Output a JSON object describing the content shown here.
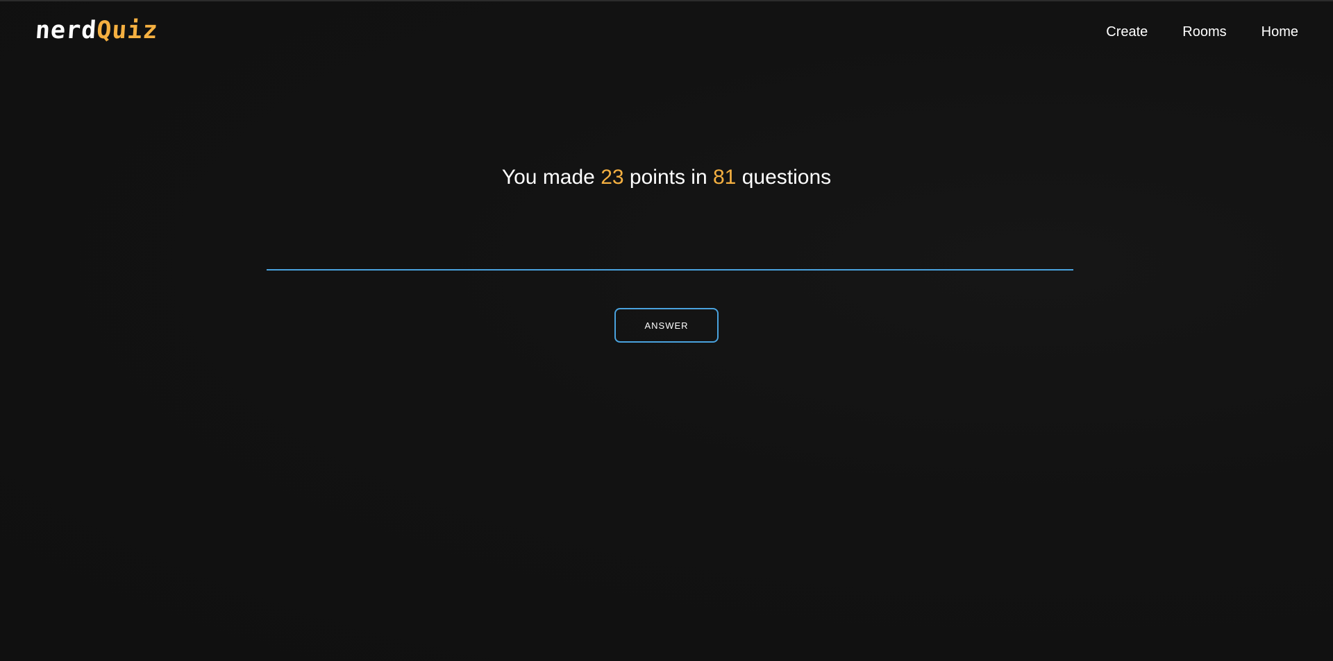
{
  "logo": {
    "part1": "nerd",
    "part2": "Quiz"
  },
  "nav": {
    "items": [
      {
        "label": "Create"
      },
      {
        "label": "Rooms"
      },
      {
        "label": "Home"
      }
    ]
  },
  "result": {
    "prefix": "You made ",
    "points": "23",
    "middle": " points in ",
    "questions": "81",
    "suffix": " questions"
  },
  "answer": {
    "value": "",
    "placeholder": "",
    "button_label": "ANSWER"
  },
  "colors": {
    "background": "#121212",
    "accent_orange": "#f5b041",
    "accent_blue": "#4aa3df",
    "text": "#ffffff"
  }
}
